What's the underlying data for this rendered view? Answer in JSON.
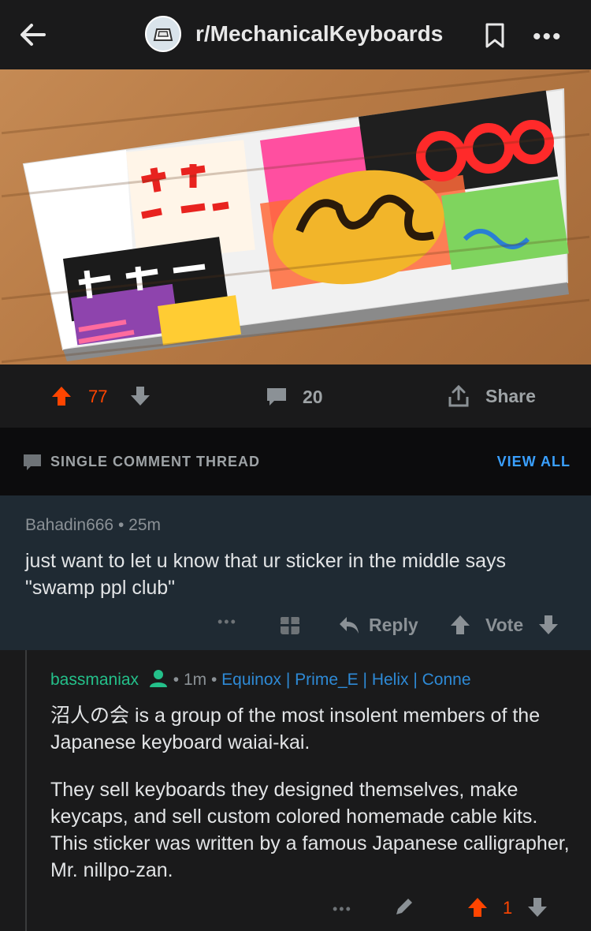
{
  "header": {
    "subreddit": "r/MechanicalKeyboards"
  },
  "post": {
    "image_alt": "",
    "upvotes": "77",
    "comments": "20",
    "share_label": "Share"
  },
  "thread": {
    "label": "SINGLE COMMENT THREAD",
    "view_all": "VIEW ALL"
  },
  "parent_comment": {
    "author": "Bahadin666",
    "time": "25m",
    "body": "just want to let u know that ur sticker in the middle says \"swamp ppl club\"",
    "reply_label": "Reply",
    "vote_label": "Vote"
  },
  "reply_comment": {
    "author": "bassmaniax",
    "time": "1m",
    "flair": "Equinox | Prime_E | Helix | Conne",
    "paragraph1": "沼人の会 is a group of the most insolent members of the Japanese keyboard waiai-kai.",
    "paragraph2": "They sell keyboards they designed themselves, make keycaps, and sell custom colored homemade cable kits. This sticker was written by a famous Japanese calligrapher, Mr. nillpo-zan.",
    "score": "1"
  },
  "colors": {
    "upvote": "#ff4500",
    "accent_blue": "#3aa0ff",
    "username_green": "#24c08a"
  }
}
